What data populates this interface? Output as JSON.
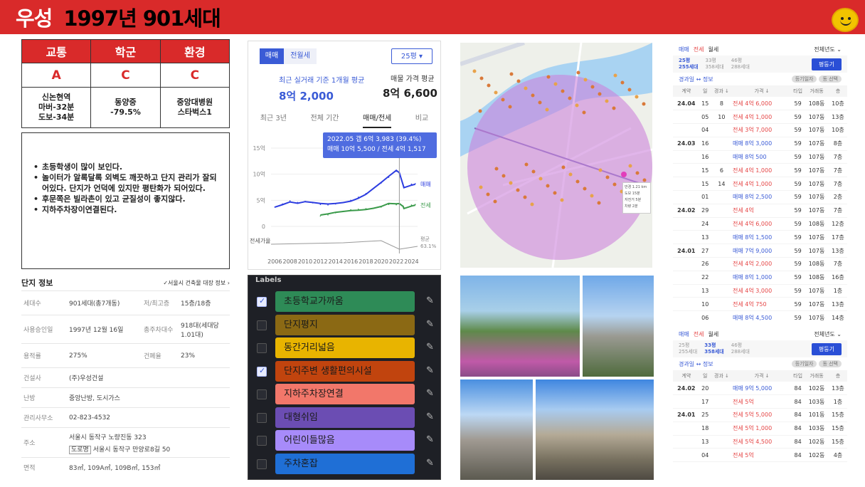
{
  "header": {
    "city": "우성",
    "info": "1997년 901세대"
  },
  "grades": {
    "headers": [
      "교통",
      "학군",
      "환경"
    ],
    "values": [
      "A",
      "C",
      "C"
    ],
    "details": [
      [
        "신논현역",
        "마버-32분",
        "도보-34분"
      ],
      [
        "동양중",
        "-79.5%"
      ],
      [
        "중앙대병원",
        "스타벅스1"
      ]
    ]
  },
  "notes": [
    "초등학생이 많이 보인다.",
    "놀이터가 알록달록 외벽도 깨끗하고 단지 관리가 잘되어있다. 단지가 언덕에 있지만 평탄화가 되어있다.",
    "후문쪽은 빌라촌이 있고 균질성이 좋지않다.",
    "지하주차장이연결된다."
  ],
  "complex_info": {
    "title": "단지 정보",
    "link": "서울시 건축물 대장 정보",
    "rows": [
      {
        "k1": "세대수",
        "v1": "901세대(총7개동)",
        "k2": "저/최고층",
        "v2": "15층/18층"
      },
      {
        "k1": "사용승인일",
        "v1": "1997년 12월 16일",
        "k2": "총주차대수",
        "v2": "918대(세대당 1.01대)"
      },
      {
        "k1": "용적률",
        "v1": "275%",
        "k2": "건폐율",
        "v2": "23%"
      },
      {
        "k1": "건설사",
        "v1": "(주)우성건설"
      },
      {
        "k1": "난방",
        "v1": "중앙난방, 도시가스"
      },
      {
        "k1": "관리사무소",
        "v1": "02-823-4532"
      },
      {
        "k1": "주소",
        "v1": "서울시 동작구 노량진동 323",
        "road_tag": "도로명",
        "v1b": "서울시 동작구 만양로8길 50"
      },
      {
        "k1": "면적",
        "v1": "83㎡, 109A㎡, 109B㎡, 153㎡"
      }
    ]
  },
  "price_panel": {
    "tab_sale": "매매",
    "tab_jeonse": "전월세",
    "pyeong": "25평",
    "recent_label": "최근 실거래 기준 1개월 평균",
    "recent_price": "8억 2,000",
    "listing_label": "매물 가격 평균",
    "listing_price": "8억 6,600",
    "tabs": [
      "최근 3년",
      "전체 기간",
      "매매/전세",
      "비교"
    ],
    "tooltip_line1": "2022.05  갭 6억 3,983 (39.4%)",
    "tooltip_line2": "매매 10억 5,500 / 전세 4억 1,517",
    "legend_sale": "매매",
    "legend_jeonse": "전세",
    "gap_label": "전세가율",
    "avg_label": "평균",
    "avg_value": "63.1%"
  },
  "chart_data": {
    "type": "line",
    "x_ticks": [
      "2006",
      "2008",
      "2010",
      "2012",
      "2014",
      "2016",
      "2018",
      "2020",
      "2022",
      "2024"
    ],
    "y_ticks": [
      "15억",
      "10억",
      "5억",
      "0"
    ],
    "ylim": [
      0,
      15
    ],
    "x": [
      2006,
      2007,
      2008,
      2009,
      2010,
      2011,
      2012,
      2013,
      2014,
      2015,
      2016,
      2017,
      2018,
      2019,
      2020,
      2021,
      2022,
      2022.4,
      2022.9,
      2023,
      2024,
      2024.5
    ],
    "series": [
      {
        "name": "매매",
        "values": [
          3.7,
          4.3,
          4.9,
          4.6,
          4.8,
          4.5,
          4.2,
          4.1,
          4.3,
          4.6,
          5.0,
          5.6,
          6.3,
          7.3,
          8.3,
          9.4,
          10.55,
          10.2,
          8.0,
          7.6,
          8.1,
          8.2
        ]
      },
      {
        "name": "전세",
        "values": [
          null,
          null,
          null,
          null,
          null,
          null,
          2.0,
          2.2,
          2.6,
          2.9,
          3.2,
          3.3,
          3.4,
          3.5,
          3.7,
          4.2,
          4.15,
          4.3,
          3.9,
          3.6,
          4.1,
          4.2
        ]
      }
    ]
  },
  "listing": {
    "tabs": [
      "매매",
      "전세",
      "월세"
    ],
    "year": "전체년도",
    "types": [
      [
        "25평",
        "255세대"
      ],
      [
        "33평",
        "358세대"
      ],
      [
        "46평",
        "288세대"
      ]
    ],
    "btn": "평둥기",
    "elapsed": "경과일 ↔ 정보",
    "chips": [
      "등기일자",
      "동 선택"
    ],
    "cols": [
      "계약",
      "일",
      "경과 ↓",
      "가격 ↓",
      "타입",
      "거래동",
      "층"
    ],
    "rows": [
      [
        "24.04",
        "15",
        "8",
        "전세",
        "4억 6,000",
        "59",
        "108동",
        "10층"
      ],
      [
        "",
        "05",
        "10",
        "전세",
        "4억 1,000",
        "59",
        "107동",
        "13층"
      ],
      [
        "",
        "04",
        "",
        "전세",
        "3억 7,000",
        "59",
        "107동",
        "10층"
      ],
      [
        "24.03",
        "16",
        "",
        "매매",
        "8억 3,000",
        "59",
        "107동",
        "8층"
      ],
      [
        "",
        "16",
        "",
        "매매",
        "8억 500",
        "59",
        "107동",
        "7층"
      ],
      [
        "",
        "15",
        "6",
        "전세",
        "4억 1,000",
        "59",
        "107동",
        "7층"
      ],
      [
        "",
        "15",
        "14",
        "전세",
        "4억 1,000",
        "59",
        "107동",
        "7층"
      ],
      [
        "",
        "01",
        "",
        "매매",
        "8억 2,500",
        "59",
        "107동",
        "2층"
      ],
      [
        "24.02",
        "29",
        "",
        "전세",
        "4억",
        "59",
        "107동",
        "7층"
      ],
      [
        "",
        "24",
        "",
        "전세",
        "4억 6,000",
        "59",
        "108동",
        "12층"
      ],
      [
        "",
        "13",
        "",
        "매매",
        "8억 1,500",
        "59",
        "107동",
        "17층"
      ],
      [
        "24.01",
        "27",
        "",
        "매매",
        "7억 9,000",
        "59",
        "107동",
        "13층"
      ],
      [
        "",
        "26",
        "",
        "전세",
        "4억 2,000",
        "59",
        "108동",
        "7층"
      ],
      [
        "",
        "22",
        "",
        "매매",
        "8억 1,000",
        "59",
        "108동",
        "16층"
      ],
      [
        "",
        "13",
        "",
        "전세",
        "4억 3,000",
        "59",
        "107동",
        "1층"
      ],
      [
        "",
        "10",
        "",
        "전세",
        "4억 750",
        "59",
        "107동",
        "13층"
      ],
      [
        "",
        "06",
        "",
        "매매",
        "8억 4,500",
        "59",
        "107동",
        "14층"
      ]
    ]
  },
  "listing2": {
    "tabs": [
      "매매",
      "전세",
      "월세"
    ],
    "year": "전체년도",
    "types": [
      [
        "25평",
        "255세대"
      ],
      [
        "33평",
        "358세대"
      ],
      [
        "46평",
        "288세대"
      ]
    ],
    "btn": "평둥기",
    "elapsed": "경과일 ↔ 정보",
    "chips": [
      "등기일자",
      "동 선택"
    ],
    "cols": [
      "계약",
      "일",
      "경과 ↓",
      "가격 ↓",
      "타입",
      "거래동",
      "층"
    ],
    "rows": [
      [
        "24.02",
        "20",
        "",
        "매매",
        "9억 5,000",
        "84",
        "102동",
        "13층"
      ],
      [
        "",
        "17",
        "",
        "전세",
        "5억",
        "84",
        "103동",
        "1층"
      ],
      [
        "24.01",
        "25",
        "",
        "전세",
        "5억 5,000",
        "84",
        "101동",
        "15층"
      ],
      [
        "",
        "18",
        "",
        "전세",
        "5억 1,000",
        "84",
        "103동",
        "15층"
      ],
      [
        "",
        "13",
        "",
        "전세",
        "5억 4,500",
        "84",
        "102동",
        "15층"
      ],
      [
        "",
        "04",
        "",
        "전세",
        "5억",
        "84",
        "102동",
        "4층"
      ]
    ]
  },
  "labels": {
    "title": "Labels",
    "items": [
      {
        "text": "초등학교가까움",
        "color": "#2e8b57",
        "checked": true
      },
      {
        "text": "단지평지",
        "color": "#8b6914",
        "checked": false
      },
      {
        "text": "동간거리넓음",
        "color": "#e8b400",
        "checked": false
      },
      {
        "text": "단지주변 생활편의시설",
        "color": "#c1440e",
        "checked": true
      },
      {
        "text": "지하주차장연결",
        "color": "#f2776a",
        "checked": false
      },
      {
        "text": "대형쉬임",
        "color": "#6b4db3",
        "checked": false
      },
      {
        "text": "어린이들많음",
        "color": "#a78bfa",
        "checked": false
      },
      {
        "text": "주차혼잡",
        "color": "#1f6fd6",
        "checked": false
      }
    ]
  },
  "map_popup": {
    "lines": [
      "반경 1.21 km",
      "도보 15분",
      "자전거 5분",
      "차량 2분"
    ]
  }
}
